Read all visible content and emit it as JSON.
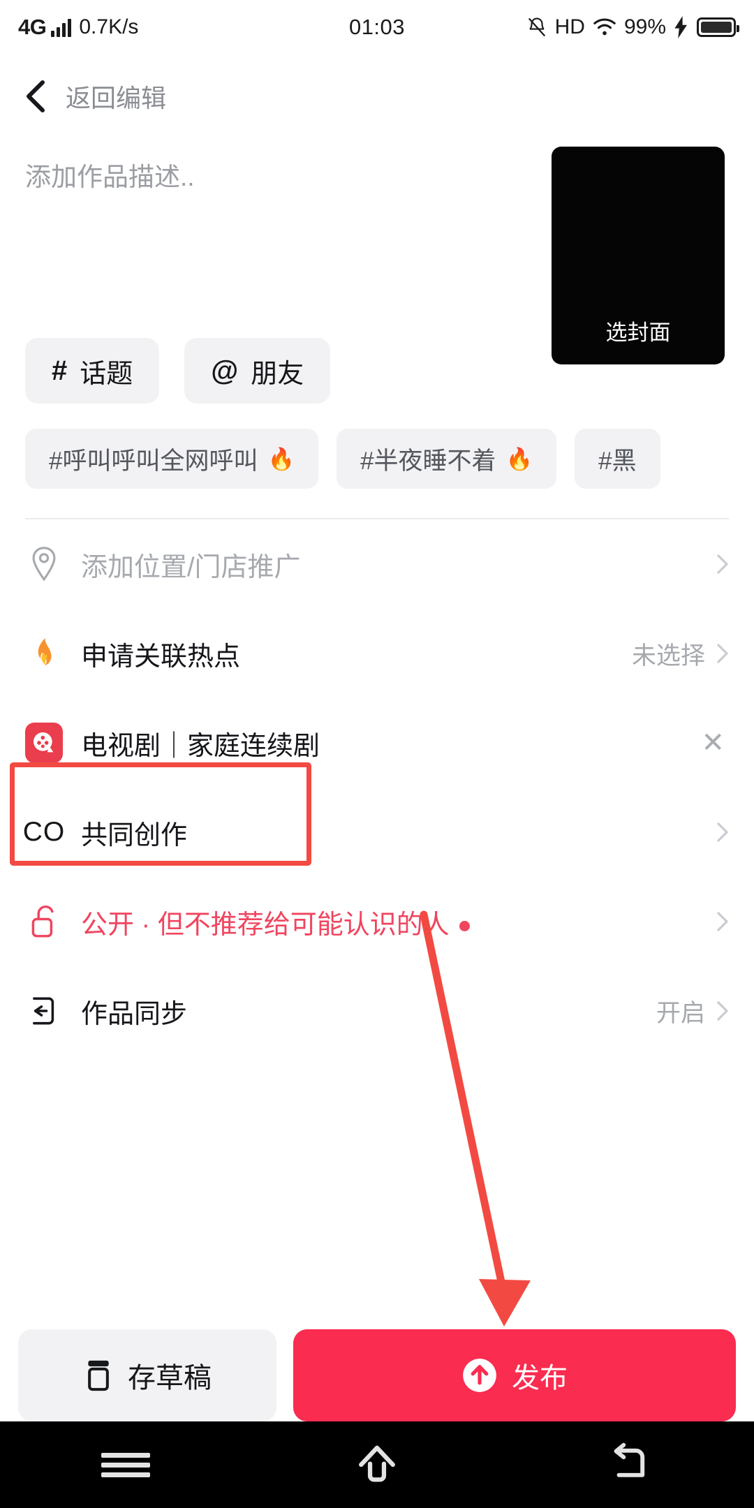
{
  "statusbar": {
    "network": "4G",
    "speed": "0.7K/s",
    "time": "01:03",
    "hd": "HD",
    "battery_percent": "99%",
    "icons": [
      "signal-bars-icon",
      "mute-bell-icon",
      "hd-icon",
      "wifi-icon",
      "charging-bolt-icon",
      "battery-icon"
    ]
  },
  "header": {
    "back_label": "返回编辑"
  },
  "editor": {
    "description_placeholder": "添加作品描述..",
    "cover_label": "选封面"
  },
  "chips": [
    {
      "symbol": "#",
      "label": "话题",
      "name": "topic"
    },
    {
      "symbol": "@",
      "label": "朋友",
      "name": "friend"
    }
  ],
  "suggested_tags": [
    {
      "label": "#呼叫呼叫全网呼叫",
      "flame": "🔥"
    },
    {
      "label": "#半夜睡不着",
      "flame": "🔥"
    },
    {
      "label": "#黑",
      "flame": ""
    }
  ],
  "rows": [
    {
      "name": "location",
      "icon": "location-pin-icon",
      "label": "添加位置/门店推广",
      "muted": true,
      "value": "",
      "accessory": "chevron"
    },
    {
      "name": "hot-topic",
      "icon": "flame-icon",
      "label": "申请关联热点",
      "muted": false,
      "value": "未选择",
      "accessory": "chevron"
    },
    {
      "name": "tv-series",
      "icon": "film-reel-icon",
      "label": "电视剧｜家庭连续剧",
      "muted": false,
      "value": "",
      "accessory": "close"
    },
    {
      "name": "co-creation",
      "icon": "co-icon",
      "label": "共同创作",
      "muted": false,
      "value": "",
      "accessory": "chevron"
    },
    {
      "name": "privacy",
      "icon": "unlock-icon",
      "label": "公开 · 但不推荐给可能认识的人",
      "muted": false,
      "value": "",
      "accessory": "chevron",
      "pink": true,
      "dot": true
    },
    {
      "name": "sync",
      "icon": "sync-icon",
      "label": "作品同步",
      "muted": false,
      "value": "开启",
      "accessory": "chevron"
    }
  ],
  "co_mark": "CO",
  "actions": {
    "draft_label": "存草稿",
    "publish_label": "发布"
  },
  "android_nav": [
    "menu-icon",
    "home-icon",
    "back-icon"
  ],
  "colors": {
    "accent": "#fa2c50",
    "pink": "#f0455f",
    "highlight": "#f24a42",
    "chip_bg": "#f2f2f4",
    "muted_text": "#a6a9ae"
  }
}
